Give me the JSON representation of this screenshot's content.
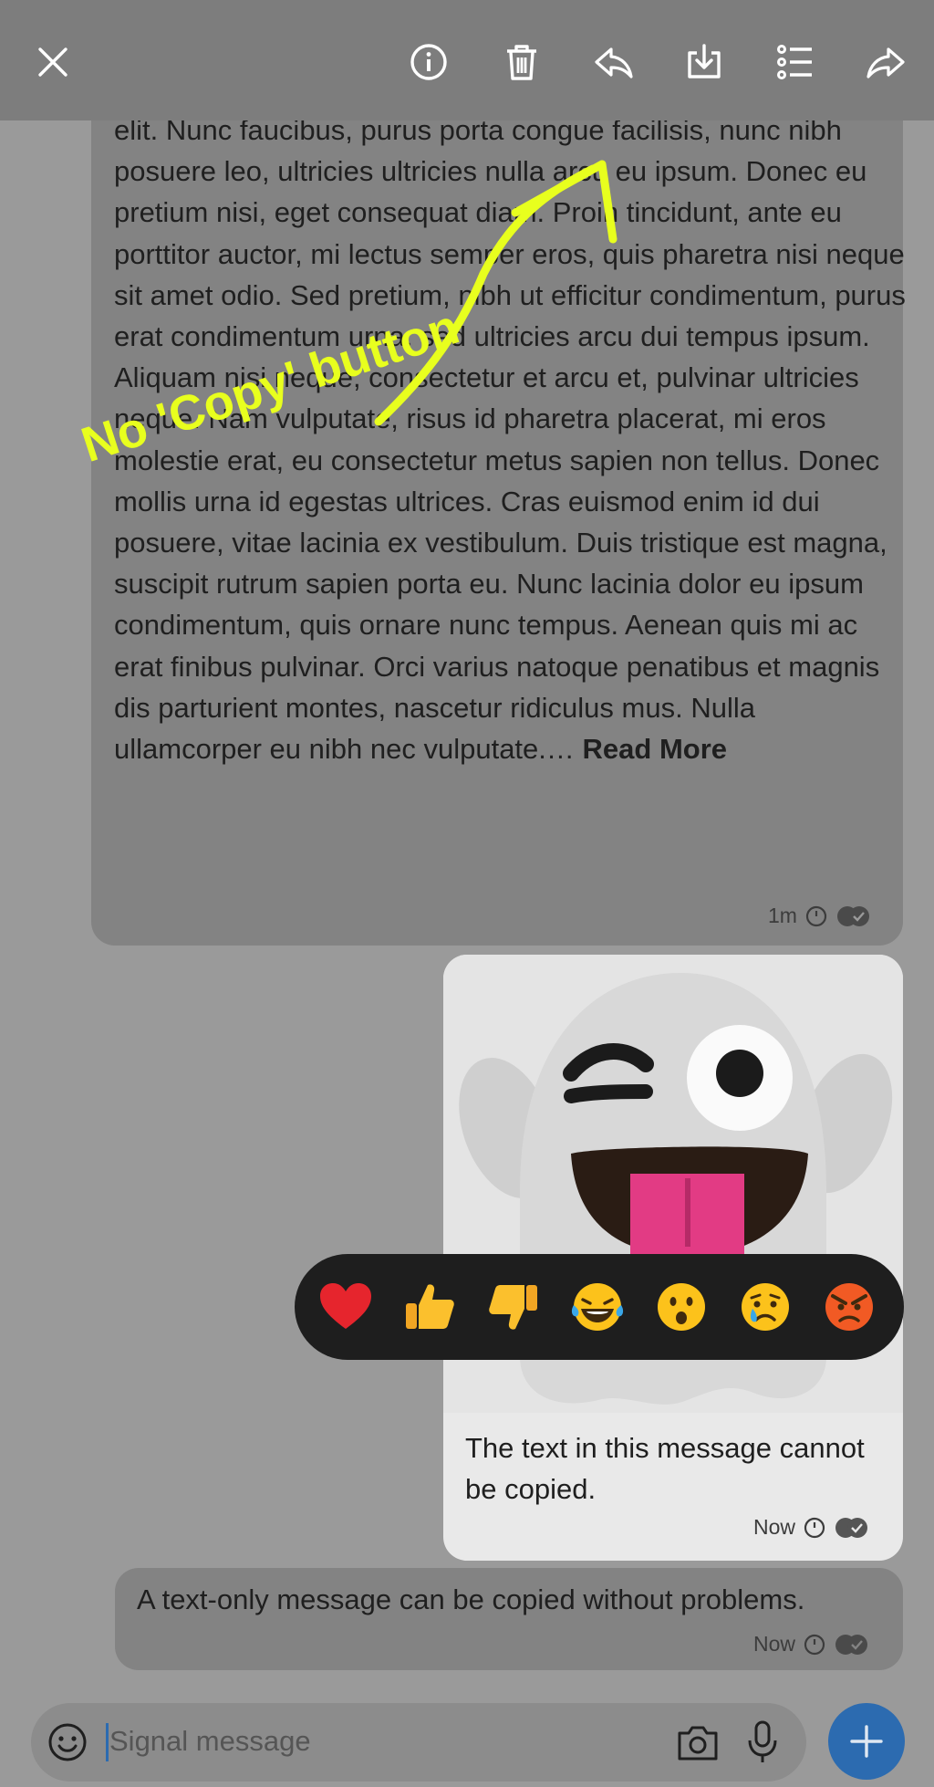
{
  "toolbar": {
    "icons": [
      "close-icon",
      "info-icon",
      "trash-icon",
      "reply-icon",
      "save-icon",
      "select-multiple-icon",
      "forward-icon"
    ]
  },
  "messages": {
    "long": {
      "text": "elit. Nunc faucibus, purus porta congue facilisis, nunc nibh posuere leo, ultricies ultricies nulla arcu eu ipsum. Donec eu pretium nisi, eget consequat diam. Proin tincidunt, ante eu porttitor auctor, mi lectus semper eros, quis pharetra nisi neque sit amet odio. Sed pretium, nibh ut efficitur condimentum, purus erat condimentum urna, sed ultricies arcu dui tempus ipsum. Aliquam nisi neque, consectetur et arcu et, pulvinar ultricies neque. Nam vulputate, risus id pharetra placerat, mi eros molestie erat, eu consectetur metus sapien non tellus. Donec mollis urna id egestas ultrices. Cras euismod enim id dui posuere, vitae lacinia ex vestibulum. Duis tristique est magna, suscipit rutrum sapien porta eu. Nunc lacinia dolor eu ipsum condimentum, quis ornare nunc tempus. Aenean quis mi ac erat finibus pulvinar. Orci varius natoque penatibus et magnis dis parturient montes, nascetur ridiculus mus. Nulla ullamcorper eu nibh nec vulputate.…",
      "read_more": "Read More",
      "time": "1m"
    },
    "sticker": {
      "caption": "The text in this message cannot be copied.",
      "time": "Now"
    },
    "text_only": {
      "text": "A text-only message can be copied without problems.",
      "time": "Now"
    }
  },
  "reactions": [
    "❤️",
    "👍",
    "👎",
    "😂",
    "😮",
    "😢",
    "😡"
  ],
  "composer": {
    "placeholder": "Signal message"
  },
  "annotation": {
    "label": "No 'Copy' button",
    "color": "#e8ff1e"
  },
  "colors": {
    "send_button": "#2c6bb0"
  }
}
